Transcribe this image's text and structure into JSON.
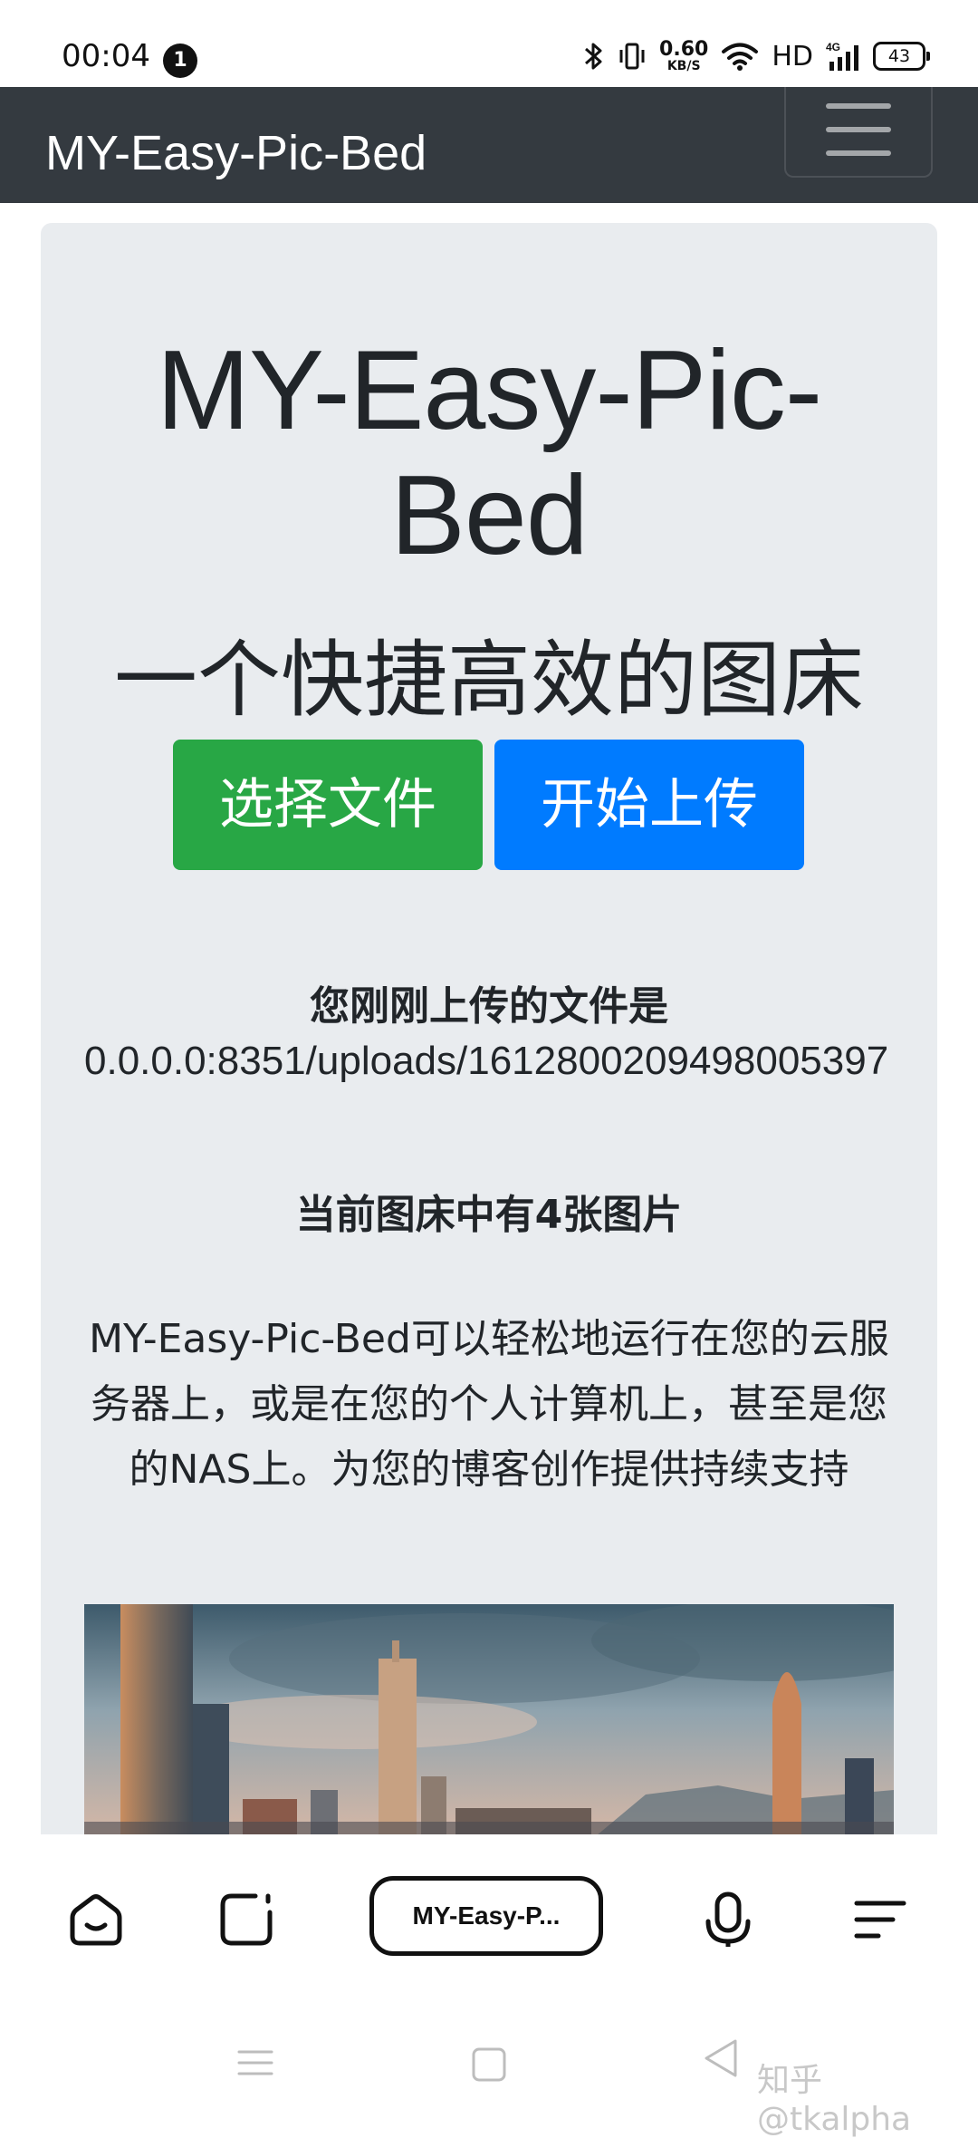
{
  "status_bar": {
    "time": "00:04",
    "notification_count": "1",
    "net_speed_value": "0.60",
    "net_speed_unit": "KB/S",
    "network_label": "HD",
    "signal_label": "4G",
    "battery_level": "43",
    "icons": [
      "bluetooth-icon",
      "vibrate-icon",
      "wifi-icon",
      "signal-icon",
      "battery-icon"
    ]
  },
  "navbar": {
    "brand": "MY-Easy-Pic-Bed",
    "toggler_icon": "hamburger-menu-icon"
  },
  "jumbotron": {
    "title_line1": "MY-Easy-Pic-",
    "title_line2": "Bed",
    "subtitle": "一个快捷高效的图床",
    "choose_file_button": "选择文件",
    "upload_button": "开始上传",
    "uploaded_label": "您刚刚上传的文件是",
    "uploaded_path": "0.0.0.0:8351/uploads/1612800209498005397",
    "count_text": "当前图床中有4张图片",
    "description": "MY-Easy-Pic-Bed可以轻松地运行在您的云服务器上，或是在您的个人计算机上，甚至是您的NAS上。为您的博客创作提供持续支持"
  },
  "colors": {
    "navbar_bg": "#343a40",
    "jumbotron_bg": "#e9ecef",
    "success": "#28a745",
    "primary": "#007bff"
  },
  "browser_toolbar": {
    "url_text": "MY-Easy-P...",
    "icons": [
      "home-icon",
      "tabs-icon",
      "microphone-icon",
      "menu-icon"
    ]
  },
  "system_nav": {
    "icons": [
      "recent-apps-icon",
      "home-square-icon",
      "back-icon"
    ],
    "watermark": "知乎 @tkalpha"
  }
}
